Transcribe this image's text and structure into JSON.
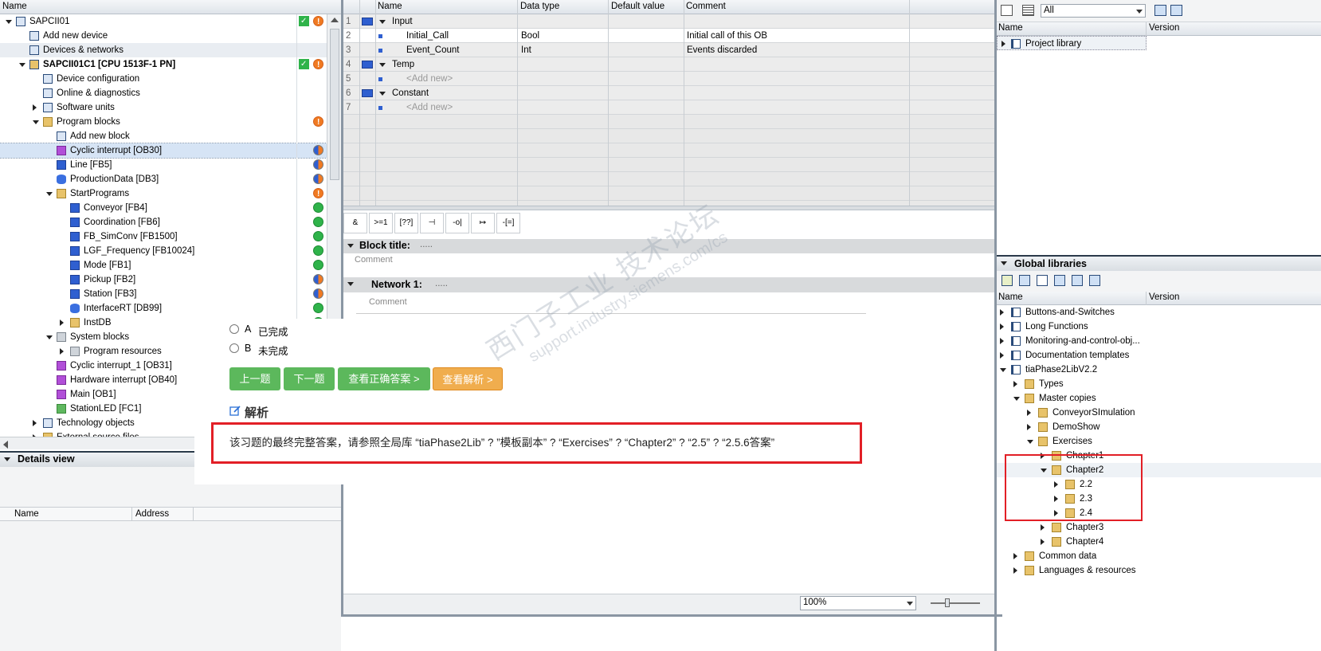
{
  "tree": {
    "header": "Name",
    "items": [
      {
        "label": "SAPCII01",
        "level": 0,
        "exp": "d",
        "icon": "project-icon",
        "status": [
          "check",
          "warn"
        ]
      },
      {
        "label": "Add new device",
        "level": 1,
        "exp": "",
        "icon": "add-device-icon",
        "status": []
      },
      {
        "label": "Devices & networks",
        "level": 1,
        "exp": "",
        "icon": "network-icon",
        "status": []
      },
      {
        "label": "SAPCII01C1 [CPU 1513F-1 PN]",
        "level": 1,
        "exp": "d",
        "icon": "cpu-icon",
        "status": [
          "check",
          "warn"
        ],
        "bold": true
      },
      {
        "label": "Device configuration",
        "level": 2,
        "exp": "",
        "icon": "device-config-icon",
        "status": []
      },
      {
        "label": "Online & diagnostics",
        "level": 2,
        "exp": "",
        "icon": "diagnostics-icon",
        "status": []
      },
      {
        "label": "Software units",
        "level": 2,
        "exp": "r",
        "icon": "software-units-icon",
        "status": []
      },
      {
        "label": "Program blocks",
        "level": 2,
        "exp": "d",
        "icon": "folder-icon",
        "status": [
          "warn"
        ]
      },
      {
        "label": "Add new block",
        "level": 3,
        "exp": "",
        "icon": "add-block-icon",
        "status": []
      },
      {
        "label": "Cyclic interrupt [OB30]",
        "level": 3,
        "exp": "",
        "icon": "ob-icon",
        "status": [
          "half"
        ],
        "sel": true
      },
      {
        "label": "Line [FB5]",
        "level": 3,
        "exp": "",
        "icon": "fb-icon",
        "status": [
          "half"
        ]
      },
      {
        "label": "ProductionData [DB3]",
        "level": 3,
        "exp": "",
        "icon": "db-icon",
        "status": [
          "half"
        ]
      },
      {
        "label": "StartPrograms",
        "level": 3,
        "exp": "d",
        "icon": "folder-icon",
        "status": [
          "warn"
        ]
      },
      {
        "label": "Conveyor [FB4]",
        "level": 4,
        "exp": "",
        "icon": "fb-icon",
        "status": [
          "ok"
        ]
      },
      {
        "label": "Coordination [FB6]",
        "level": 4,
        "exp": "",
        "icon": "fb-icon",
        "status": [
          "ok"
        ]
      },
      {
        "label": "FB_SimConv [FB1500]",
        "level": 4,
        "exp": "",
        "icon": "fb-icon",
        "status": [
          "ok"
        ]
      },
      {
        "label": "LGF_Frequency [FB10024]",
        "level": 4,
        "exp": "",
        "icon": "fb-icon",
        "status": [
          "ok"
        ]
      },
      {
        "label": "Mode [FB1]",
        "level": 4,
        "exp": "",
        "icon": "fb-icon",
        "status": [
          "ok"
        ]
      },
      {
        "label": "Pickup [FB2]",
        "level": 4,
        "exp": "",
        "icon": "fb-icon",
        "status": [
          "half"
        ]
      },
      {
        "label": "Station [FB3]",
        "level": 4,
        "exp": "",
        "icon": "fb-icon",
        "status": [
          "half"
        ]
      },
      {
        "label": "InterfaceRT [DB99]",
        "level": 4,
        "exp": "",
        "icon": "db-icon",
        "status": [
          "ok"
        ]
      },
      {
        "label": "InstDB",
        "level": 4,
        "exp": "r",
        "icon": "folder-icon",
        "status": [
          "ok"
        ]
      },
      {
        "label": "System blocks",
        "level": 3,
        "exp": "d",
        "icon": "system-folder-icon",
        "status": []
      },
      {
        "label": "Program resources",
        "level": 4,
        "exp": "r",
        "icon": "system-folder-icon",
        "status": []
      },
      {
        "label": "Cyclic interrupt_1 [OB31]",
        "level": 3,
        "exp": "",
        "icon": "ob-icon",
        "status": []
      },
      {
        "label": "Hardware interrupt [OB40]",
        "level": 3,
        "exp": "",
        "icon": "ob-icon",
        "status": []
      },
      {
        "label": "Main [OB1]",
        "level": 3,
        "exp": "",
        "icon": "ob-icon",
        "status": []
      },
      {
        "label": "StationLED [FC1]",
        "level": 3,
        "exp": "",
        "icon": "fc-icon",
        "status": []
      },
      {
        "label": "Technology objects",
        "level": 2,
        "exp": "r",
        "icon": "technology-icon",
        "status": []
      },
      {
        "label": "External source files",
        "level": 2,
        "exp": "r",
        "icon": "folder-icon",
        "status": []
      }
    ]
  },
  "details": {
    "title": "Details view",
    "col_name": "Name",
    "col_address": "Address"
  },
  "iface": {
    "headers": {
      "name": "Name",
      "type": "Data type",
      "default": "Default value",
      "comment": "Comment"
    },
    "rows": [
      {
        "n": "1",
        "name": "Input",
        "type": "",
        "comment": "",
        "sec": true
      },
      {
        "n": "2",
        "name": "Initial_Call",
        "type": "Bool",
        "comment": "Initial call of this OB"
      },
      {
        "n": "3",
        "name": "Event_Count",
        "type": "Int",
        "comment": "Events discarded"
      },
      {
        "n": "4",
        "name": "Temp",
        "type": "",
        "comment": "",
        "sec": true
      },
      {
        "n": "5",
        "name": "<Add new>",
        "type": "",
        "comment": "",
        "add": true
      },
      {
        "n": "6",
        "name": "Constant",
        "type": "",
        "comment": "",
        "sec": true
      },
      {
        "n": "7",
        "name": "<Add new>",
        "type": "",
        "comment": "",
        "add": true
      }
    ]
  },
  "editor": {
    "toolbar": [
      "&",
      ">=1",
      "[??]",
      "⊣",
      "-o|",
      "↦",
      "-[=]"
    ],
    "block_title": "Block title:",
    "block_dots": ".....",
    "comment": "Comment",
    "network": "Network 1:",
    "network_dots": ".....",
    "zoom": "100%"
  },
  "quiz": {
    "opt_a_letter": "A",
    "opt_a": "已完成",
    "opt_b_letter": "B",
    "opt_b": "未完成",
    "btn_prev": "上一题",
    "btn_next": "下一题",
    "btn_answer": "查看正确答案 >",
    "btn_analysis": "查看解析 >",
    "analysis_title": "解析",
    "analysis_text": "该习题的最终完整答案，请参照全局库 “tiaPhase2Lib” ? ”模板副本” ? “Exercises” ? “Chapter2” ? “2.5” ? “2.5.6答案”"
  },
  "watermark": {
    "line1": "西门子工业  技术论坛",
    "line2": "support.industry.siemens.com/cs"
  },
  "library": {
    "filter": "All",
    "col_name": "Name",
    "col_version": "Version",
    "project_library": "Project library",
    "global_title": "Global libraries",
    "items": [
      {
        "label": "Buttons-and-Switches",
        "level": 0,
        "exp": "r",
        "icon": "book"
      },
      {
        "label": "Long Functions",
        "level": 0,
        "exp": "r",
        "icon": "book"
      },
      {
        "label": "Monitoring-and-control-obj...",
        "level": 0,
        "exp": "r",
        "icon": "book"
      },
      {
        "label": "Documentation templates",
        "level": 0,
        "exp": "r",
        "icon": "book"
      },
      {
        "label": "tiaPhase2LibV2.2",
        "level": 0,
        "exp": "d",
        "icon": "book"
      },
      {
        "label": "Types",
        "level": 1,
        "exp": "r",
        "icon": "folder"
      },
      {
        "label": "Master copies",
        "level": 1,
        "exp": "d",
        "icon": "folder"
      },
      {
        "label": "ConveyorSImulation",
        "level": 2,
        "exp": "r",
        "icon": "folder"
      },
      {
        "label": "DemoShow",
        "level": 2,
        "exp": "r",
        "icon": "folder"
      },
      {
        "label": "Exercises",
        "level": 2,
        "exp": "d",
        "icon": "folder"
      },
      {
        "label": "Chapter1",
        "level": 3,
        "exp": "r",
        "icon": "folder"
      },
      {
        "label": "Chapter2",
        "level": 3,
        "exp": "d",
        "icon": "folder",
        "sel": true
      },
      {
        "label": "2.2",
        "level": 4,
        "exp": "r",
        "icon": "folder"
      },
      {
        "label": "2.3",
        "level": 4,
        "exp": "r",
        "icon": "folder"
      },
      {
        "label": "2.4",
        "level": 4,
        "exp": "r",
        "icon": "folder"
      },
      {
        "label": "Chapter3",
        "level": 3,
        "exp": "r",
        "icon": "folder"
      },
      {
        "label": "Chapter4",
        "level": 3,
        "exp": "r",
        "icon": "folder"
      },
      {
        "label": "Common data",
        "level": 1,
        "exp": "r",
        "icon": "folder"
      },
      {
        "label": "Languages & resources",
        "level": 1,
        "exp": "r",
        "icon": "folder"
      }
    ]
  },
  "colors": {
    "green": "#5cb85c",
    "orange": "#f0ad4e",
    "red": "#e21f26",
    "selection": "#d6e4f5"
  }
}
